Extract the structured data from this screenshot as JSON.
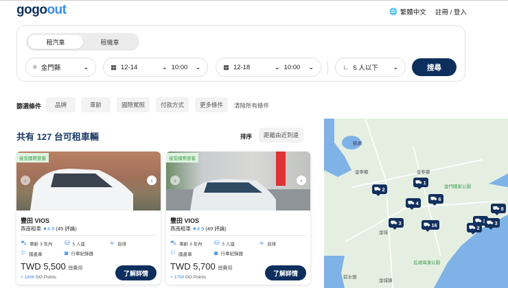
{
  "header": {
    "logo": "gogoout",
    "language": "繁體中文",
    "login": "註冊 / 登入"
  },
  "search": {
    "tabs": [
      "租汽車",
      "租機車"
    ],
    "location": "金門縣",
    "pickup_date": "12-14",
    "pickup_time": "10:00",
    "return_date": "12-18",
    "return_time": "10:00",
    "passengers": "5 人以下",
    "search_label": "搜尋"
  },
  "filters": {
    "label": "篩選條件",
    "chips": [
      "品牌",
      "車齡",
      "國際駕照",
      "付款方式",
      "更多條件"
    ],
    "clear": "清除所有條件"
  },
  "results": {
    "count_text": "共有 127 台可租車輛",
    "sort_label": "排序",
    "sort_value": "距離由近到遠"
  },
  "cards": [
    {
      "badge": "接受國際旅客",
      "name": "豐田 VIOS",
      "shop": "燕南租車",
      "rating": "★4.9",
      "reviews": "(49 評論)",
      "specs": [
        "車齡 3 年內",
        "5 人座",
        "自排",
        "國產車",
        "行車紀錄器"
      ],
      "price": "TWD 5,500",
      "price_note": "總費用",
      "points": "+ 1696",
      "points_label": "GO Points",
      "button": "了解詳情"
    },
    {
      "badge": "接受國際旅客",
      "name": "豐田 VIOS",
      "shop": "燕南租車",
      "rating": "★4.9",
      "reviews": "(49 評論)",
      "specs": [
        "車齡 3 年內",
        "5 人座",
        "自排",
        "國產車",
        "行車紀錄器"
      ],
      "price": "TWD 5,700",
      "price_note": "總費用",
      "points": "+ 1758",
      "points_label": "GO Points",
      "button": "了解詳情"
    }
  ],
  "map": {
    "labels": [
      "金寧鄉",
      "金寧鄉",
      "金門國家公園",
      "金城",
      "后湖海濱公園",
      "金城鎮",
      "前水頭",
      "慈湖"
    ],
    "pins": [
      "1",
      "2",
      "4",
      "6",
      "3",
      "16",
      "3",
      "3",
      "8",
      "2"
    ]
  }
}
